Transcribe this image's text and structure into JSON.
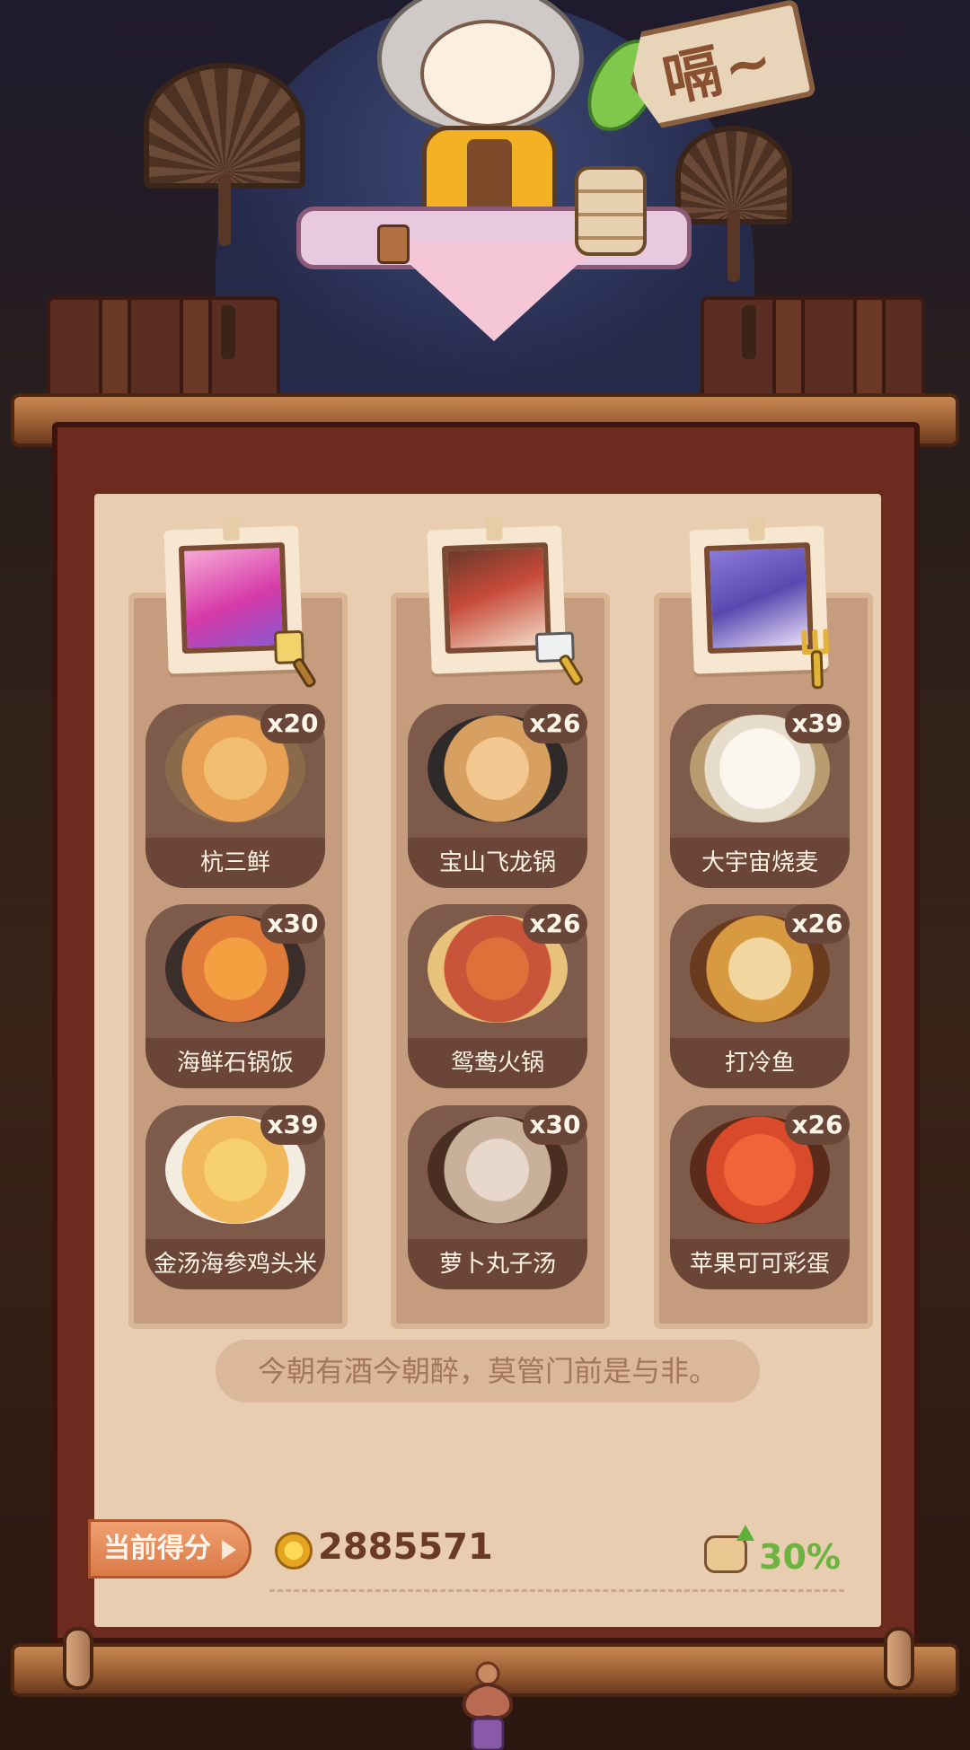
{
  "sign": {
    "text": "嗝~"
  },
  "chefs": [
    {
      "portrait": "chef-pink-hair",
      "tool": "golden-spatula-icon"
    },
    {
      "portrait": "chef-brown-hair",
      "tool": "golden-cleaver-icon"
    },
    {
      "portrait": "chef-purple-hair",
      "tool": "golden-fork-icon"
    }
  ],
  "dishes": [
    [
      {
        "name": "杭三鲜",
        "count": "x20",
        "color": "#e8a055"
      },
      {
        "name": "海鲜石锅饭",
        "count": "x30",
        "color": "#e07a3a"
      },
      {
        "name": "金汤海参鸡头米",
        "count": "x39",
        "color": "#f0b85a"
      }
    ],
    [
      {
        "name": "宝山飞龙锅",
        "count": "x26",
        "color": "#d8a060"
      },
      {
        "name": "鸳鸯火锅",
        "count": "x26",
        "color": "#c8553a"
      },
      {
        "name": "萝卜丸子汤",
        "count": "x30",
        "color": "#c9b09a"
      }
    ],
    [
      {
        "name": "大宇宙烧麦",
        "count": "x39",
        "color": "#f3ece0"
      },
      {
        "name": "打冷鱼",
        "count": "x26",
        "color": "#d89a40"
      },
      {
        "name": "苹果可可彩蛋",
        "count": "x26",
        "color": "#d84a2a"
      }
    ]
  ],
  "quote": "今朝有酒今朝醉，莫管门前是与非。",
  "score": {
    "label": "当前得分",
    "value": "2885571",
    "bonus": "30%"
  }
}
